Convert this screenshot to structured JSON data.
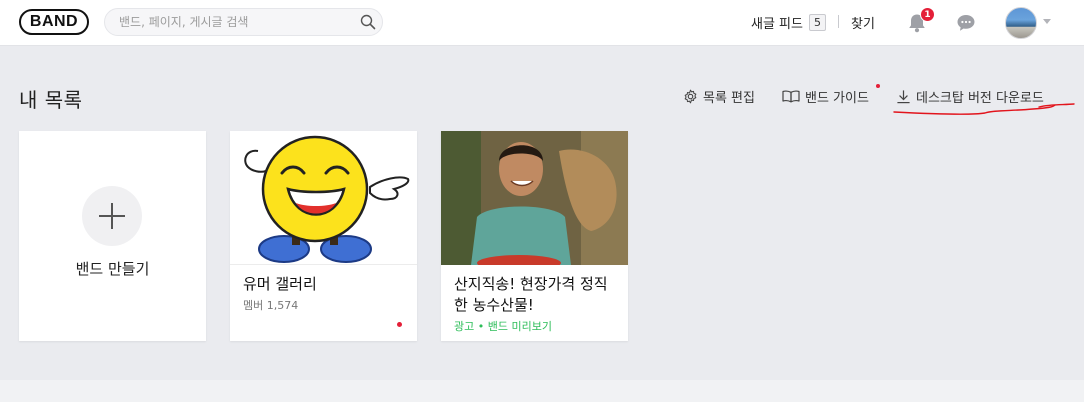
{
  "header": {
    "logo": "BAND",
    "search_placeholder": "밴드, 페이지, 게시글 검색",
    "feed_label": "새글 피드",
    "feed_count": "5",
    "find_label": "찾기",
    "notification_count": "1"
  },
  "main": {
    "title": "내 목록",
    "actions": {
      "edit": "목록 편집",
      "guide": "밴드 가이드",
      "download": "데스크탑 버전 다운로드"
    },
    "create_card": {
      "label": "밴드 만들기"
    },
    "bands": [
      {
        "name": "유머 갤러리",
        "members": "멤버 1,574",
        "has_new": true
      }
    ],
    "ad": {
      "title": "산지직송! 현장가격 정직한 농수산물!",
      "meta": "광고 • 밴드 미리보기"
    }
  },
  "colors": {
    "accent_red": "#e41f38",
    "ad_green": "#2dbd59",
    "background": "#eaebef"
  },
  "icons": [
    "search-icon",
    "bell-icon",
    "chat-icon",
    "gear-icon",
    "book-icon",
    "download-icon",
    "plus-icon"
  ]
}
